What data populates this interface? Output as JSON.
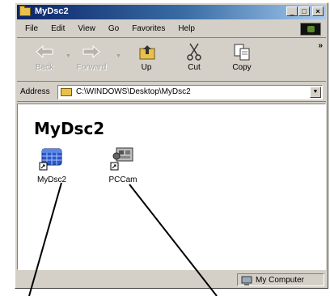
{
  "window": {
    "title": "MyDsc2",
    "controls": {
      "minimize": "_",
      "maximize": "□",
      "close": "×"
    }
  },
  "menu": {
    "items": [
      "File",
      "Edit",
      "View",
      "Go",
      "Favorites",
      "Help"
    ]
  },
  "toolbar": {
    "buttons": [
      {
        "label": "Back",
        "icon": "back-arrow-icon",
        "enabled": false
      },
      {
        "label": "Forward",
        "icon": "forward-arrow-icon",
        "enabled": false
      },
      {
        "label": "Up",
        "icon": "up-folder-icon",
        "enabled": true
      },
      {
        "label": "Cut",
        "icon": "scissors-icon",
        "enabled": true
      },
      {
        "label": "Copy",
        "icon": "copy-icon",
        "enabled": true
      }
    ],
    "more": "»"
  },
  "address": {
    "label": "Address",
    "value": "C:\\WINDOWS\\Desktop\\MyDsc2"
  },
  "content": {
    "folder_title": "MyDsc2",
    "icons": [
      {
        "label": "MyDsc2",
        "icon": "database-shortcut-icon"
      },
      {
        "label": "PCCam",
        "icon": "camera-shortcut-icon"
      }
    ]
  },
  "status": {
    "text": "My Computer",
    "icon": "computer-icon"
  },
  "colors": {
    "titlebar_start": "#0a246a",
    "titlebar_end": "#a6caf0",
    "window_face": "#d4d0c8"
  }
}
